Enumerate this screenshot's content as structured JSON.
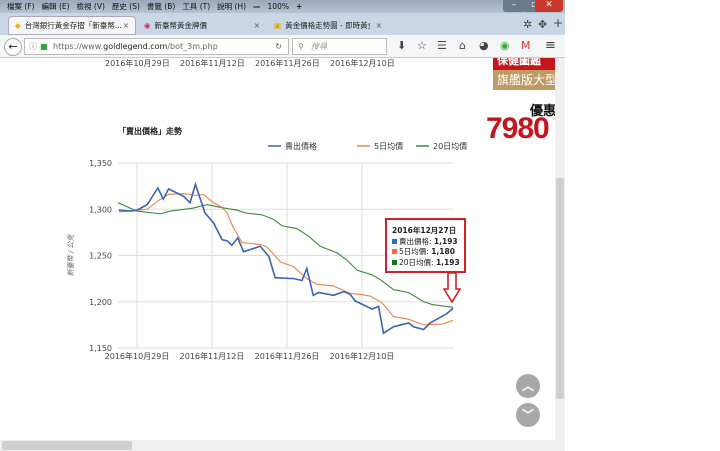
{
  "menu": [
    "檔案 (F)",
    "編輯 (E)",
    "檢視 (V)",
    "歷史 (S)",
    "書籤 (B)",
    "工具 (T)",
    "說明 (H)"
  ],
  "zoom": "100%",
  "tabs": [
    {
      "label": "台灣銀行黃金存摺「新臺幣...",
      "active": true
    },
    {
      "label": "新臺幣黃金牌價",
      "active": false
    },
    {
      "label": "黃金價格走勢圖 - 即時黃金...",
      "active": false
    }
  ],
  "url": {
    "prefix": "https://www.",
    "domain": "goldlegend.com",
    "path": "/bot_3m.php"
  },
  "search_placeholder": "搜尋",
  "top_dates": [
    "2016年10月29日",
    "2016年11月12日",
    "2016年11月26日",
    "2016年12月10日"
  ],
  "ad": {
    "line1": "保健圖鑑",
    "line2": "旗艦版大型",
    "line3": "優惠",
    "price": "7980"
  },
  "tooltip": {
    "date": "2016年12月27日",
    "rows": [
      {
        "label": "賣出價格: ",
        "value": "1,193",
        "color": "#3366cc"
      },
      {
        "label": "5日均價: ",
        "value": "1,180",
        "color": "#ff6633"
      },
      {
        "label": "20日均價: ",
        "value": "1,193",
        "color": "#117711"
      }
    ]
  },
  "chart_data": {
    "type": "line",
    "title": "「賣出價格」走勢",
    "xlabel": "",
    "ylabel": "新臺幣 / 公克",
    "x_unit": "days since 2016年10月29日",
    "xlim": [
      -3.5,
      59
    ],
    "ylim": [
      1150,
      1350
    ],
    "yticks": [
      "1,150",
      "1,200",
      "1,250",
      "1,300",
      "1,350"
    ],
    "ytick_values": [
      1150,
      1200,
      1250,
      1300,
      1350
    ],
    "xticks": [
      "2016年10月29日",
      "2016年11月12日",
      "2016年11月26日",
      "2016年12月10日"
    ],
    "xtick_values": [
      0,
      14,
      28,
      42
    ],
    "legend_position": "top-right",
    "series": [
      {
        "name": "賣出價格",
        "color": "#3b63b8",
        "points": [
          [
            -3.4,
            1299
          ],
          [
            -1.2,
            1298
          ],
          [
            0,
            1299
          ],
          [
            1.9,
            1305
          ],
          [
            3.9,
            1323
          ],
          [
            4.9,
            1311
          ],
          [
            5.9,
            1322
          ],
          [
            8.7,
            1314
          ],
          [
            9.9,
            1307
          ],
          [
            10.9,
            1327
          ],
          [
            12.7,
            1296
          ],
          [
            14.3,
            1285
          ],
          [
            15.9,
            1267
          ],
          [
            16.8,
            1266
          ],
          [
            17.7,
            1261
          ],
          [
            18.8,
            1269
          ],
          [
            19.9,
            1254
          ],
          [
            23,
            1260
          ],
          [
            24.6,
            1249
          ],
          [
            25.8,
            1226
          ],
          [
            29.3,
            1225
          ],
          [
            30.8,
            1223
          ],
          [
            31.7,
            1236
          ],
          [
            32.9,
            1207
          ],
          [
            33.9,
            1210
          ],
          [
            36.7,
            1207
          ],
          [
            38.6,
            1211
          ],
          [
            39.8,
            1208
          ],
          [
            40.7,
            1201
          ],
          [
            43.9,
            1192
          ],
          [
            45.1,
            1195
          ],
          [
            46,
            1166
          ],
          [
            47.9,
            1173
          ],
          [
            50.7,
            1177
          ],
          [
            51.6,
            1173
          ],
          [
            53.5,
            1170
          ],
          [
            54.7,
            1177
          ],
          [
            57.8,
            1187
          ],
          [
            59,
            1193
          ]
        ]
      },
      {
        "name": "5日均價",
        "color": "#f08040",
        "points": [
          [
            -3.4,
            1297
          ],
          [
            0,
            1299
          ],
          [
            1.9,
            1300
          ],
          [
            3.9,
            1309
          ],
          [
            5.9,
            1316
          ],
          [
            8.7,
            1317
          ],
          [
            10.9,
            1315
          ],
          [
            12.4,
            1316
          ],
          [
            14.3,
            1307
          ],
          [
            15.9,
            1302
          ],
          [
            16.8,
            1296
          ],
          [
            18,
            1280
          ],
          [
            19.6,
            1264
          ],
          [
            23,
            1262
          ],
          [
            24.3,
            1259
          ],
          [
            26.8,
            1243
          ],
          [
            29.2,
            1238
          ],
          [
            31.7,
            1225
          ],
          [
            33.6,
            1219
          ],
          [
            36.7,
            1217
          ],
          [
            39.8,
            1209
          ],
          [
            41.7,
            1208
          ],
          [
            43.6,
            1206
          ],
          [
            45.7,
            1199
          ],
          [
            47.9,
            1184
          ],
          [
            50.7,
            1181
          ],
          [
            53.5,
            1175
          ],
          [
            57.2,
            1176
          ],
          [
            59,
            1180
          ]
        ]
      },
      {
        "name": "20日均價",
        "color": "#3a8a3a",
        "points": [
          [
            -4,
            1307
          ],
          [
            0,
            1298
          ],
          [
            4.4,
            1295
          ],
          [
            6.2,
            1298
          ],
          [
            10.3,
            1301
          ],
          [
            13.1,
            1305
          ],
          [
            15.6,
            1302
          ],
          [
            18.7,
            1299
          ],
          [
            20.2,
            1296
          ],
          [
            23.3,
            1294
          ],
          [
            25.5,
            1289
          ],
          [
            27.1,
            1282
          ],
          [
            29.9,
            1279
          ],
          [
            32,
            1271
          ],
          [
            34.2,
            1260
          ],
          [
            37.3,
            1253
          ],
          [
            39.2,
            1245
          ],
          [
            41.1,
            1234
          ],
          [
            43.9,
            1229
          ],
          [
            45.4,
            1224
          ],
          [
            47.9,
            1213
          ],
          [
            50.7,
            1210
          ],
          [
            53.5,
            1200
          ],
          [
            55.1,
            1197
          ],
          [
            59,
            1194
          ]
        ]
      }
    ]
  }
}
